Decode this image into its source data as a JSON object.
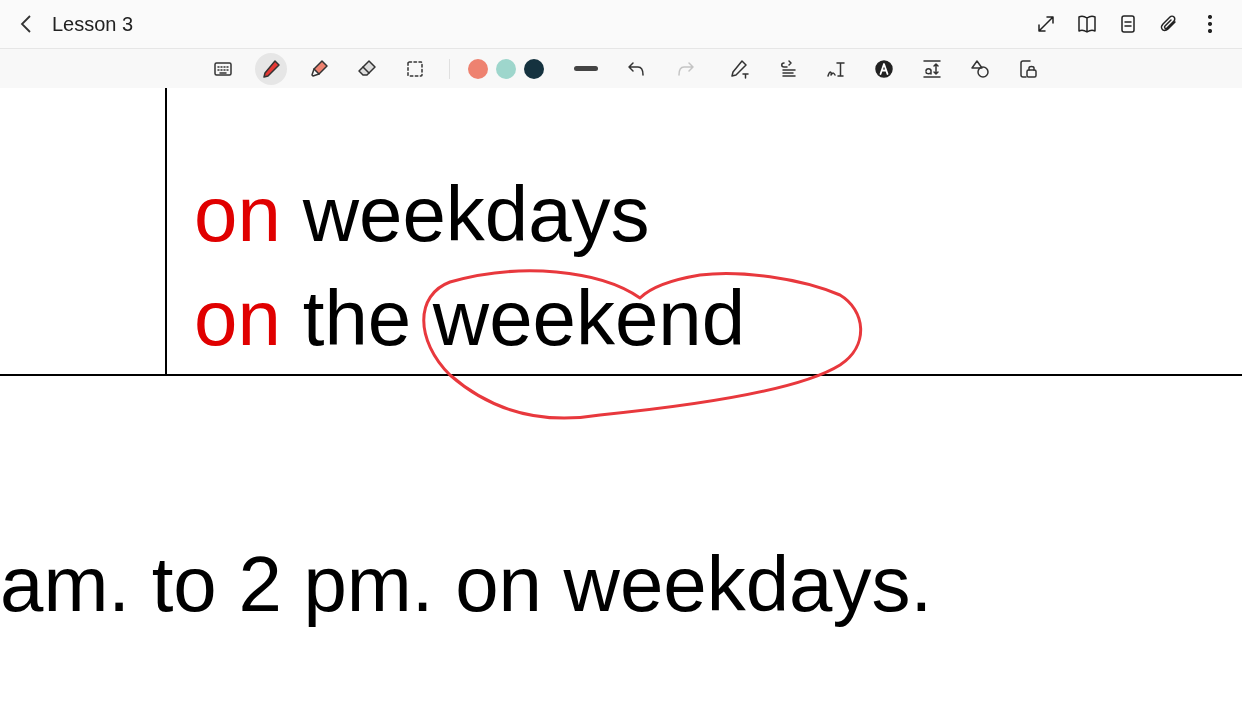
{
  "header": {
    "title": "Lesson 3",
    "actions": [
      {
        "kind": "expand"
      },
      {
        "kind": "book"
      },
      {
        "kind": "note"
      },
      {
        "kind": "clip"
      },
      {
        "kind": "more"
      }
    ]
  },
  "toolbar": {
    "tools": [
      {
        "kind": "keyboard",
        "selected": false
      },
      {
        "kind": "pen",
        "selected": true
      },
      {
        "kind": "highlighter",
        "selected": false
      },
      {
        "kind": "eraser",
        "selected": false
      },
      {
        "kind": "select",
        "selected": false
      }
    ],
    "colors": [
      {
        "color": "#ee8270"
      },
      {
        "color": "#9ed6cc"
      },
      {
        "color": "#15323f"
      }
    ],
    "history": [
      {
        "kind": "undo",
        "disabled": false
      },
      {
        "kind": "redo",
        "disabled": true
      }
    ],
    "extras": [
      {
        "kind": "pen-text"
      },
      {
        "kind": "align"
      },
      {
        "kind": "handwriting"
      },
      {
        "kind": "text-style"
      },
      {
        "kind": "text-size"
      },
      {
        "kind": "shapes"
      },
      {
        "kind": "lock"
      }
    ]
  },
  "page": {
    "lines": [
      {
        "parts": [
          {
            "text": "on",
            "color": "#e00000"
          },
          {
            "text": "weekdays",
            "color": "#000000"
          }
        ]
      },
      {
        "parts": [
          {
            "text": "on",
            "color": "#e00000"
          },
          {
            "text": "the weekend",
            "color": "#000000"
          }
        ]
      }
    ],
    "sentence": "am. to 2 pm. on weekdays.",
    "ink": {
      "color": "#e8383d"
    }
  }
}
